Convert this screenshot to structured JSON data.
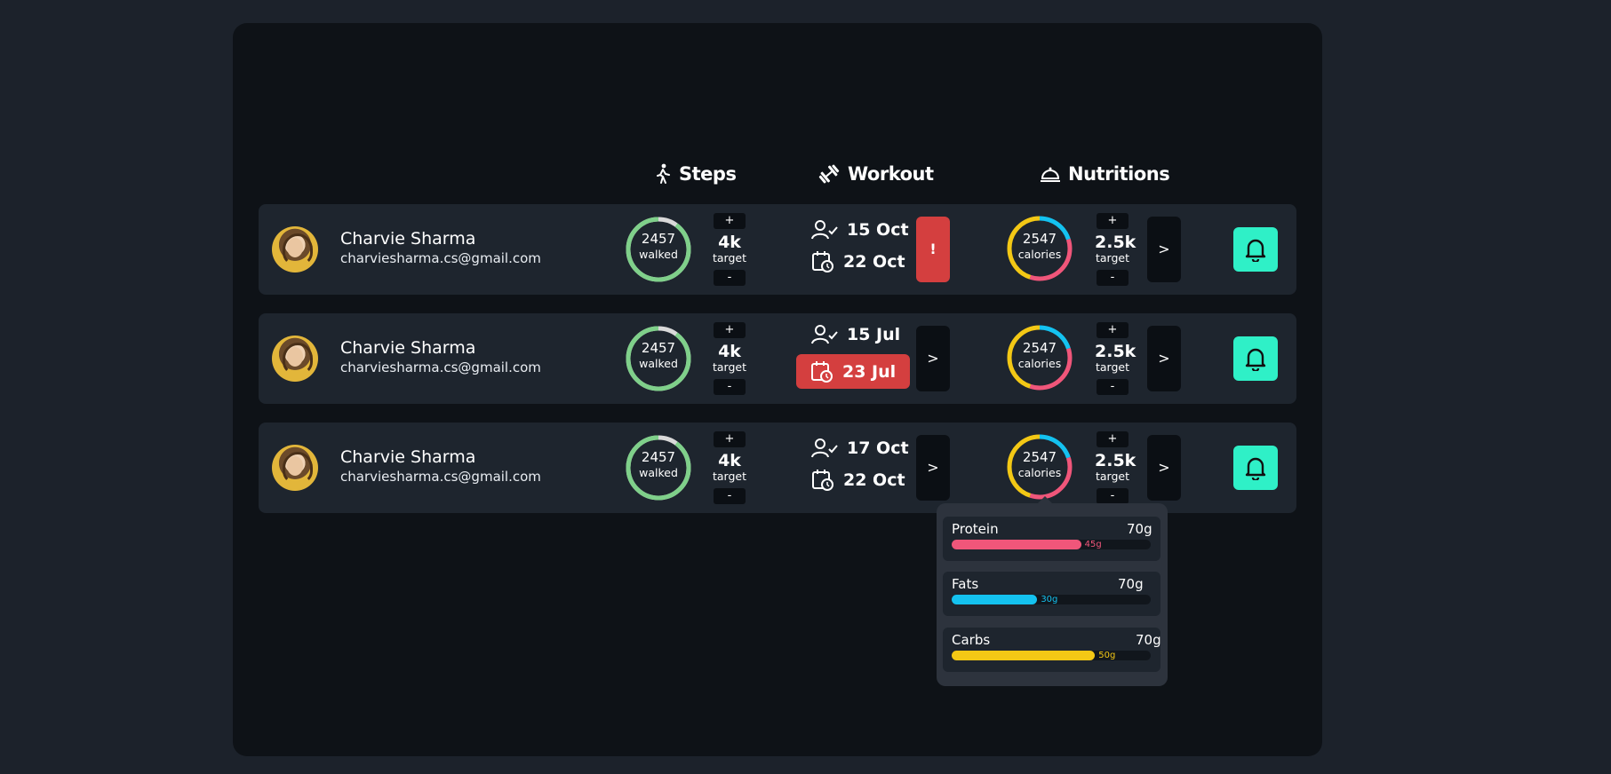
{
  "header": {
    "steps": "Steps",
    "workout": "Workout",
    "nutritions": "Nutritions"
  },
  "colors": {
    "steps_ring": "#7fd08a",
    "steps_ring_bg": "#d9d9d9",
    "protein": "#f0567a",
    "fats": "#14c2f0",
    "carbs": "#f3c815",
    "bell": "#2ff0c7",
    "alert": "#d43f3f"
  },
  "rows": [
    {
      "name": "Charvie Sharma",
      "email": "charviesharma.cs@gmail.com",
      "steps": {
        "value": "2457",
        "unit": "walked",
        "progress": 0.9
      },
      "steps_target": {
        "plus": "+",
        "value": "4k",
        "label": "target",
        "minus": "-"
      },
      "workout": {
        "done_date": "15 Oct",
        "scheduled_date": "22 Oct",
        "action": "!"
      },
      "nutrition": {
        "value": "2547",
        "unit": "calories",
        "protein_frac": 0.35,
        "fats_frac": 0.2,
        "carbs_frac": 0.45
      },
      "nutrition_target": {
        "plus": "+",
        "value": "2.5k",
        "label": "target",
        "minus": "-"
      },
      "next": ">"
    },
    {
      "name": "Charvie Sharma",
      "email": "charviesharma.cs@gmail.com",
      "steps": {
        "value": "2457",
        "unit": "walked",
        "progress": 0.9
      },
      "steps_target": {
        "plus": "+",
        "value": "4k",
        "label": "target",
        "minus": "-"
      },
      "workout": {
        "done_date": "15 Jul",
        "scheduled_date": "23 Jul",
        "action": ">"
      },
      "nutrition": {
        "value": "2547",
        "unit": "calories",
        "protein_frac": 0.35,
        "fats_frac": 0.2,
        "carbs_frac": 0.45
      },
      "nutrition_target": {
        "plus": "+",
        "value": "2.5k",
        "label": "target",
        "minus": "-"
      },
      "next": ">"
    },
    {
      "name": "Charvie Sharma",
      "email": "charviesharma.cs@gmail.com",
      "steps": {
        "value": "2457",
        "unit": "walked",
        "progress": 0.9
      },
      "steps_target": {
        "plus": "+",
        "value": "4k",
        "label": "target",
        "minus": "-"
      },
      "workout": {
        "done_date": "17 Oct",
        "scheduled_date": "22 Oct",
        "action": ">"
      },
      "nutrition": {
        "value": "2547",
        "unit": "calories",
        "protein_frac": 0.35,
        "fats_frac": 0.2,
        "carbs_frac": 0.45
      },
      "nutrition_target": {
        "plus": "+",
        "value": "2.5k",
        "label": "target",
        "minus": "-"
      },
      "next": ">"
    }
  ],
  "macros": [
    {
      "label": "Protein",
      "amount": "70g",
      "value": "45g",
      "fill": 0.65
    },
    {
      "label": "Fats",
      "amount": "70g",
      "value": "30g",
      "fill": 0.43
    },
    {
      "label": "Carbs",
      "amount": "70g",
      "value": "50g",
      "fill": 0.72
    }
  ]
}
